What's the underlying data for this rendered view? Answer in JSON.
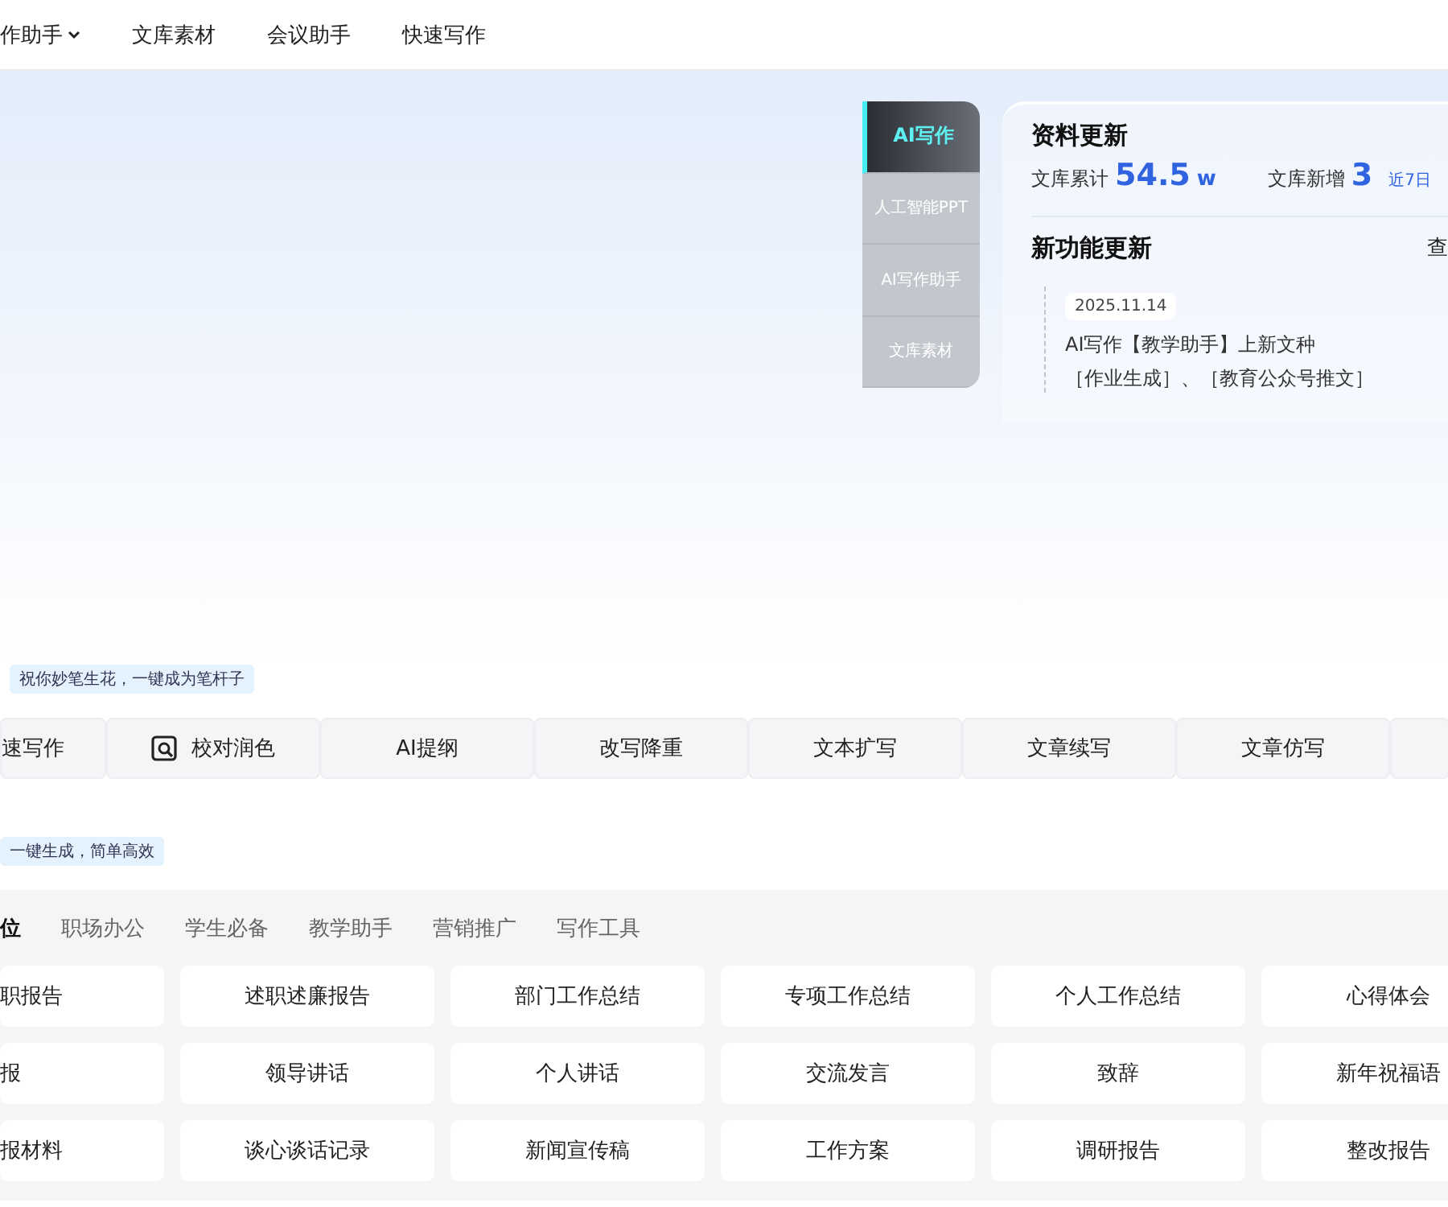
{
  "nav": {
    "items": [
      {
        "label": "作助手",
        "dropdown": true
      },
      {
        "label": "文库素材",
        "dropdown": false
      },
      {
        "label": "会议助手",
        "dropdown": false
      },
      {
        "label": "快速写作",
        "dropdown": false
      }
    ]
  },
  "hero": {
    "side_tabs": [
      {
        "label": "AI写作",
        "selected": true
      },
      {
        "label": "人工智能PPT",
        "selected": false
      },
      {
        "label": "AI写作助手",
        "selected": false
      },
      {
        "label": "文库素材",
        "selected": false
      }
    ],
    "updates": {
      "title": "资料更新",
      "total_label": "文库累计",
      "total_value": "54.5",
      "total_unit": "w",
      "new_label": "文库新增",
      "new_value": "3",
      "new_period": "近7日",
      "features_title": "新功能更新",
      "more": "查",
      "date": "2025.11.14",
      "line_1": "AI写作【教学助手】上新文种",
      "line_2": "［作业生成］、［教育公众号推文］"
    }
  },
  "tools": {
    "tag": "祝你妙笔生花，一键成为笔杆子",
    "items": [
      {
        "label": "速写作",
        "icon": false
      },
      {
        "label": "校对润色",
        "icon": true
      },
      {
        "label": "AI提纲",
        "icon": false
      },
      {
        "label": "改写降重",
        "icon": false
      },
      {
        "label": "文本扩写",
        "icon": false
      },
      {
        "label": "文章续写",
        "icon": false
      },
      {
        "label": "文章仿写",
        "icon": false
      }
    ]
  },
  "templates": {
    "tag": "一键生成，简单高效",
    "tabs": [
      {
        "label": "位",
        "selected": true
      },
      {
        "label": "职场办公",
        "selected": false
      },
      {
        "label": "学生必备",
        "selected": false
      },
      {
        "label": "教学助手",
        "selected": false
      },
      {
        "label": "营销推广",
        "selected": false
      },
      {
        "label": "写作工具",
        "selected": false
      }
    ],
    "items": [
      "职报告",
      "述职述廉报告",
      "部门工作总结",
      "专项工作总结",
      "个人工作总结",
      "心得体会",
      "报",
      "领导讲话",
      "个人讲话",
      "交流发言",
      "致辞",
      "新年祝福语",
      "报材料",
      "谈心谈话记录",
      "新闻宣传稿",
      "工作方案",
      "调研报告",
      "整改报告"
    ]
  }
}
